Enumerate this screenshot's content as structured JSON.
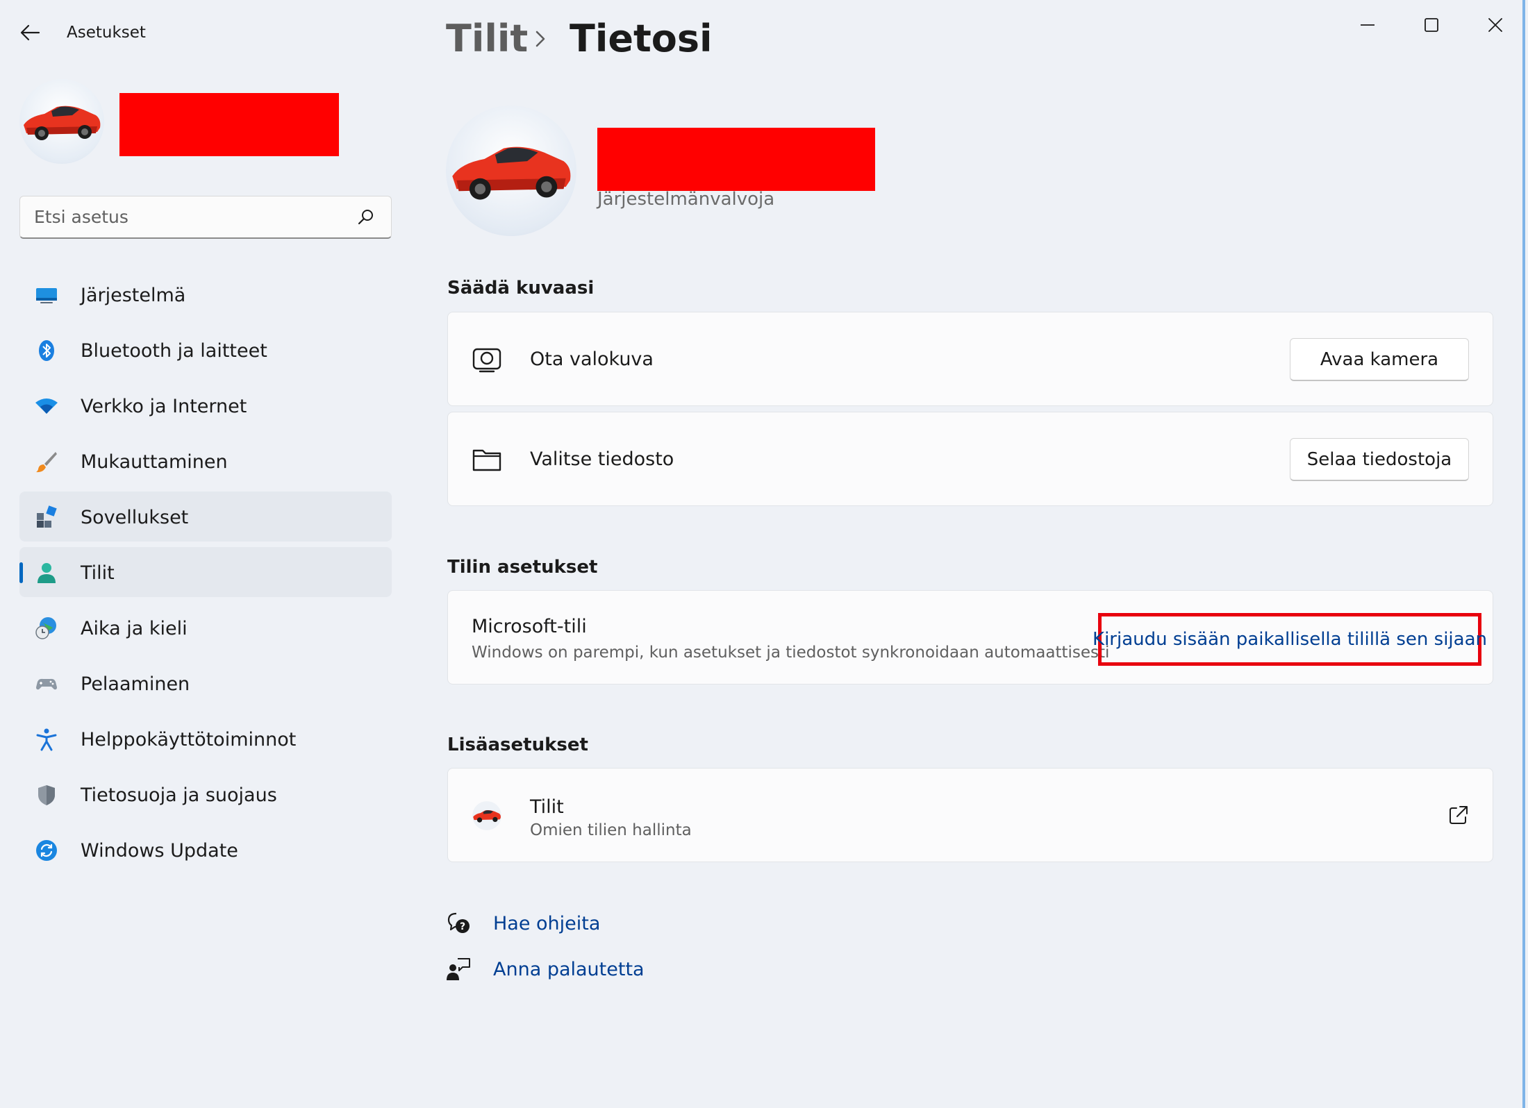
{
  "window": {
    "app_title": "Asetukset",
    "controls": [
      "minimize-icon",
      "maximize-icon",
      "close-icon"
    ]
  },
  "search": {
    "placeholder": "Etsi asetus"
  },
  "sidebar": {
    "items": [
      {
        "label": "Järjestelmä",
        "icon": "system-display-icon"
      },
      {
        "label": "Bluetooth ja laitteet",
        "icon": "bluetooth-icon"
      },
      {
        "label": "Verkko ja Internet",
        "icon": "wifi-icon"
      },
      {
        "label": "Mukauttaminen",
        "icon": "paintbrush-icon"
      },
      {
        "label": "Sovellukset",
        "icon": "apps-icon"
      },
      {
        "label": "Tilit",
        "icon": "person-icon",
        "selected": true
      },
      {
        "label": "Aika ja kieli",
        "icon": "globe-clock-icon"
      },
      {
        "label": "Pelaaminen",
        "icon": "gamepad-icon"
      },
      {
        "label": "Helppokäyttötoiminnot",
        "icon": "accessibility-icon"
      },
      {
        "label": "Tietosuoja ja suojaus",
        "icon": "shield-icon"
      },
      {
        "label": "Windows Update",
        "icon": "windows-update-icon"
      }
    ]
  },
  "breadcrumb": {
    "parent": "Tilit",
    "current": "Tietosi"
  },
  "profile": {
    "role": "Järjestelmänvalvoja"
  },
  "sections": {
    "photo": {
      "title": "Säädä kuvaasi",
      "camera_label": "Ota valokuva",
      "camera_button": "Avaa kamera",
      "file_label": "Valitse tiedosto",
      "file_button": "Selaa tiedostoja"
    },
    "account": {
      "title": "Tilin asetukset",
      "ms_label": "Microsoft-tili",
      "ms_desc": "Windows on parempi, kun asetukset ja tiedostot synkronoidaan automaattisesti",
      "local_link": "Kirjaudu sisään paikallisella tilillä sen sijaan"
    },
    "more": {
      "title": "Lisäasetukset",
      "accounts_label": "Tilit",
      "accounts_desc": "Omien tilien hallinta"
    }
  },
  "help": {
    "get_help": "Hae ohjeita",
    "feedback": "Anna palautetta"
  },
  "colors": {
    "accent": "#0067c0",
    "link": "#003e92",
    "redaction": "#ff0000",
    "highlight_box": "#e8000e"
  }
}
